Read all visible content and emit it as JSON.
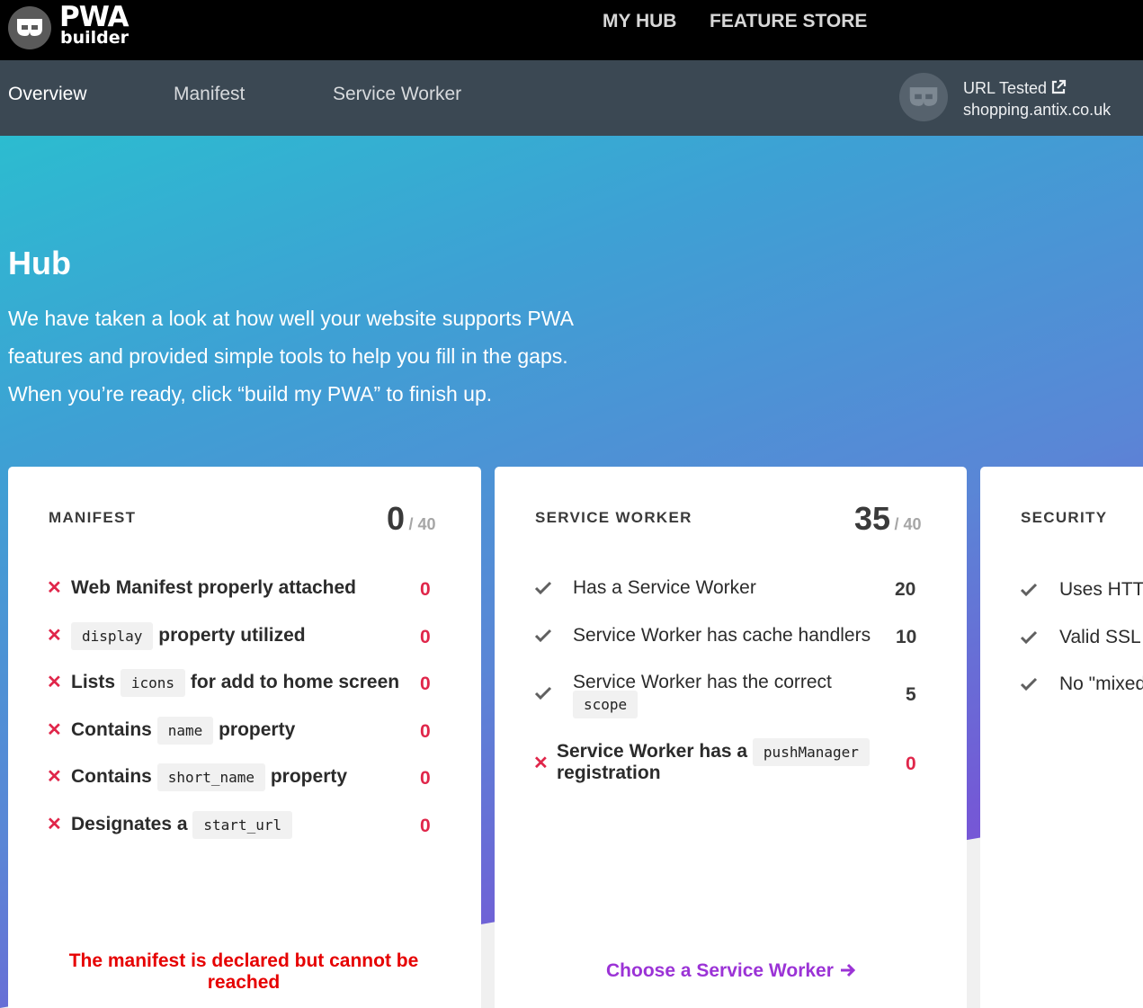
{
  "brand": {
    "line1": "PWA",
    "line2": "builder",
    "logo_icon": "pwa-mask-icon"
  },
  "topnav": {
    "my_hub": "MY HUB",
    "feature_store": "FEATURE STORE"
  },
  "subnav": {
    "tabs": [
      "Overview",
      "Manifest",
      "Service Worker"
    ],
    "active_tab": "Overview",
    "url_tested_label": "URL Tested",
    "url": "shopping.antix.co.uk"
  },
  "hero": {
    "title": "Hub",
    "lines": [
      "We have taken a look at how well your website supports PWA",
      "features and provided simple tools to help you fill in the gaps.",
      "When you’re ready, click “build my PWA” to finish up."
    ]
  },
  "manifest_card": {
    "title": "MANIFEST",
    "score": "0",
    "max": "/ 40",
    "items": [
      {
        "pre": "Web Manifest properly attached",
        "code": "",
        "post": "",
        "points": "0",
        "status": "fail"
      },
      {
        "pre": "",
        "code": "display",
        "post": "property utilized",
        "points": "0",
        "status": "fail"
      },
      {
        "pre": "Lists",
        "code": "icons",
        "post": "for add to home screen",
        "points": "0",
        "status": "fail"
      },
      {
        "pre": "Contains",
        "code": "name",
        "post": "property",
        "points": "0",
        "status": "fail"
      },
      {
        "pre": "Contains",
        "code": "short_name",
        "post": "property",
        "points": "0",
        "status": "fail"
      },
      {
        "pre": "Designates a",
        "code": "start_url",
        "post": "",
        "points": "0",
        "status": "fail"
      }
    ],
    "error": "The manifest is declared but cannot be reached"
  },
  "sw_card": {
    "title": "SERVICE WORKER",
    "score": "35",
    "max": "/ 40",
    "items": [
      {
        "text": "Has a Service Worker",
        "points": "20",
        "status": "pass"
      },
      {
        "text": "Service Worker has cache handlers",
        "points": "10",
        "status": "pass"
      },
      {
        "text": "Service Worker has the correct",
        "code": "scope",
        "points": "5",
        "status": "pass"
      },
      {
        "text": "Service Worker has a",
        "code": "pushManager",
        "text2": "registration",
        "points": "0",
        "status": "fail"
      }
    ],
    "action": "Choose a Service Worker"
  },
  "security_card": {
    "title": "SECURITY",
    "items": [
      "Uses HTTP",
      "Valid SSL c",
      "No \"mixed"
    ]
  },
  "colors": {
    "fail": "#e0264a",
    "action": "#9b33d6",
    "topbar": "#000000",
    "subnav": "#3b4853"
  }
}
